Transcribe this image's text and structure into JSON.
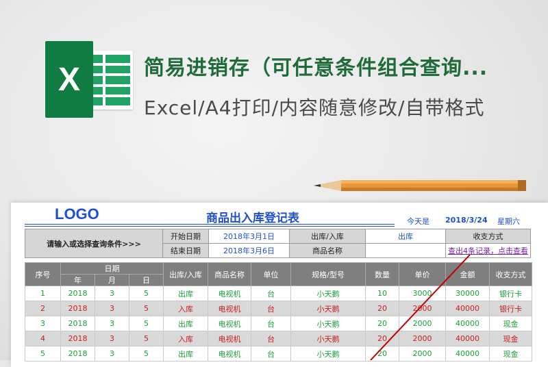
{
  "banner": {
    "title": "简易进销存（可任意条件组合查询...",
    "subtitle": "Excel/A4打印/内容随意修改/自带格式",
    "excel_letter": "X"
  },
  "sheet": {
    "logo": "LOGO",
    "title": "商品出入库登记表",
    "today_label": "今天是",
    "today_value": "2018/3/24",
    "weekday": "星期六"
  },
  "query": {
    "prompt": "请输入或选择查询条件>>>",
    "start_label": "开始日期",
    "start_value": "2018年3月1日",
    "end_label": "结束日期",
    "end_value": "2018年3月6日",
    "io_label": "出库/入库",
    "io_value": "出库",
    "product_label": "商品名称",
    "product_value": "",
    "payment_label": "收支方式",
    "payment_value": "",
    "result_link": "查出4条记录，点击查看"
  },
  "table": {
    "headers": {
      "index": "序号",
      "date": "日期",
      "year": "年",
      "month": "月",
      "day": "日",
      "io": "出库/入库",
      "product": "商品名称",
      "unit": "单位",
      "spec": "规格/型号",
      "qty": "数量",
      "price": "单价",
      "amount": "金额",
      "payment": "收支方式"
    },
    "rows": [
      {
        "index": "1",
        "year": "2018",
        "month": "3",
        "day": "5",
        "io": "出库",
        "product": "电视机",
        "unit": "台",
        "spec": "小天鹅",
        "qty": "10",
        "price": "3000",
        "amount": "30000",
        "payment": "银行卡",
        "color": "g"
      },
      {
        "index": "2",
        "year": "2018",
        "month": "3",
        "day": "5",
        "io": "入库",
        "product": "电视机",
        "unit": "台",
        "spec": "小天鹅",
        "qty": "20",
        "price": "2000",
        "amount": "40000",
        "payment": "银行卡",
        "color": "r"
      },
      {
        "index": "3",
        "year": "2018",
        "month": "3",
        "day": "5",
        "io": "出库",
        "product": "电视机",
        "unit": "台",
        "spec": "小天鹅",
        "qty": "20",
        "price": "2000",
        "amount": "40000",
        "payment": "现金",
        "color": "g"
      },
      {
        "index": "4",
        "year": "2018",
        "month": "3",
        "day": "5",
        "io": "入库",
        "product": "电视机",
        "unit": "台",
        "spec": "小天鹅",
        "qty": "20",
        "price": "2000",
        "amount": "40000",
        "payment": "现金",
        "color": "r"
      },
      {
        "index": "5",
        "year": "2018",
        "month": "3",
        "day": "5",
        "io": "出库",
        "product": "电视机",
        "unit": "台",
        "spec": "小天鹅",
        "qty": "20",
        "price": "2000",
        "amount": "40000",
        "payment": "现金",
        "color": "g"
      }
    ]
  },
  "colors": {
    "excel_green": "#107c41",
    "title_blue": "#1f4fd1",
    "out_green": "#1a9e3a",
    "in_red": "#c81e1e",
    "annotation_red": "#c00000"
  },
  "icons": [
    "excel-logo-icon",
    "pencil-icon"
  ]
}
